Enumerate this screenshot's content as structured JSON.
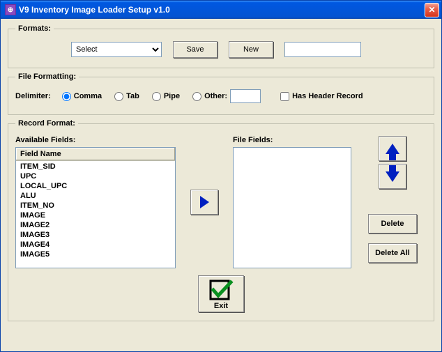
{
  "window": {
    "title": "V9 Inventory Image Loader Setup v1.0"
  },
  "formats": {
    "legend": "Formats:",
    "select_options": [
      "Select"
    ],
    "select_value": "Select",
    "save_label": "Save",
    "new_label": "New",
    "name_value": ""
  },
  "file_formatting": {
    "legend": "File Formatting:",
    "delimiter_label": "Delimiter:",
    "options": {
      "comma": "Comma",
      "tab": "Tab",
      "pipe": "Pipe",
      "other": "Other:"
    },
    "selected": "comma",
    "other_value": "",
    "header_label": "Has Header Record",
    "header_checked": false
  },
  "record_format": {
    "legend": "Record Format:",
    "available_label": "Available Fields:",
    "field_name_header": "Field Name",
    "available_fields": [
      "ITEM_SID",
      "UPC",
      "LOCAL_UPC",
      "ALU",
      "ITEM_NO",
      "IMAGE",
      "IMAGE2",
      "IMAGE3",
      "IMAGE4",
      "IMAGE5"
    ],
    "file_fields_label": "File Fields:",
    "file_fields": [],
    "delete_label": "Delete",
    "delete_all_label": "Delete All"
  },
  "exit_label": "Exit"
}
